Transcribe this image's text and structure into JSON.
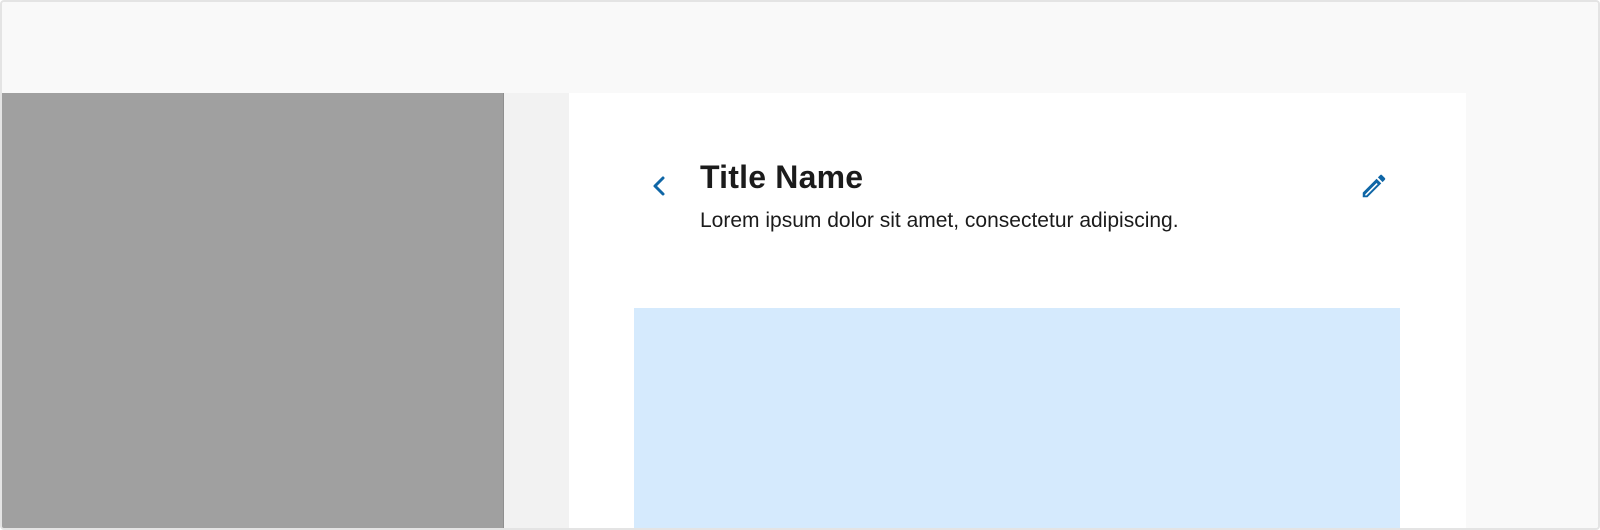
{
  "header": {
    "title": "Title Name",
    "subtitle": "Lorem ipsum dolor sit amet, consectetur adipiscing."
  },
  "icons": {
    "back": "chevron-left-icon",
    "edit": "pencil-icon"
  },
  "colors": {
    "accent": "#0f66a6",
    "side_panel": "#a0a0a0",
    "content_block": "#d5eafd",
    "text": "#1b1b1b"
  }
}
